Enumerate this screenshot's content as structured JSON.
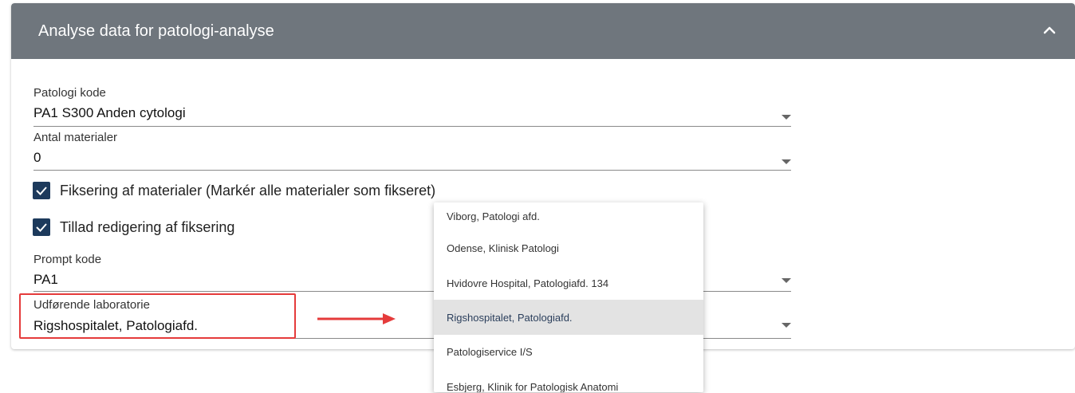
{
  "panel": {
    "title": "Analyse data for patologi-analyse"
  },
  "fields": {
    "patologi_kode": {
      "label": "Patologi kode",
      "value": "PA1 S300 Anden cytologi"
    },
    "antal_materialer": {
      "label": "Antal materialer",
      "value": "0"
    },
    "prompt_kode": {
      "label": "Prompt kode",
      "value": "PA1"
    },
    "udforende_lab": {
      "label": "Udførende laboratorie",
      "value": "Rigshospitalet, Patologiafd."
    }
  },
  "checkboxes": [
    {
      "label": "Fiksering af materialer (Markér alle materialer som fikseret)",
      "checked": true
    },
    {
      "label": "Tillad redigering af fiksering",
      "checked": true
    }
  ],
  "dropdown": {
    "options": [
      "Viborg, Patologi afd.",
      "Odense, Klinisk Patologi",
      "Hvidovre Hospital, Patologiafd. 134",
      "Rigshospitalet, Patologiafd.",
      "Patologiservice I/S",
      "Esbjerg, Klinik for Patologisk Anatomi"
    ],
    "selected": "Rigshospitalet, Patologiafd."
  },
  "colors": {
    "header_bg": "#6f767d",
    "checkbox": "#1d3a5c",
    "highlight": "#e53b3b",
    "selected_option_bg": "#e3e3e3"
  },
  "icons": {
    "collapse": "chevron-up-icon",
    "dropdown": "caret-down-icon",
    "check": "check-icon",
    "arrow": "arrow-right-icon"
  }
}
